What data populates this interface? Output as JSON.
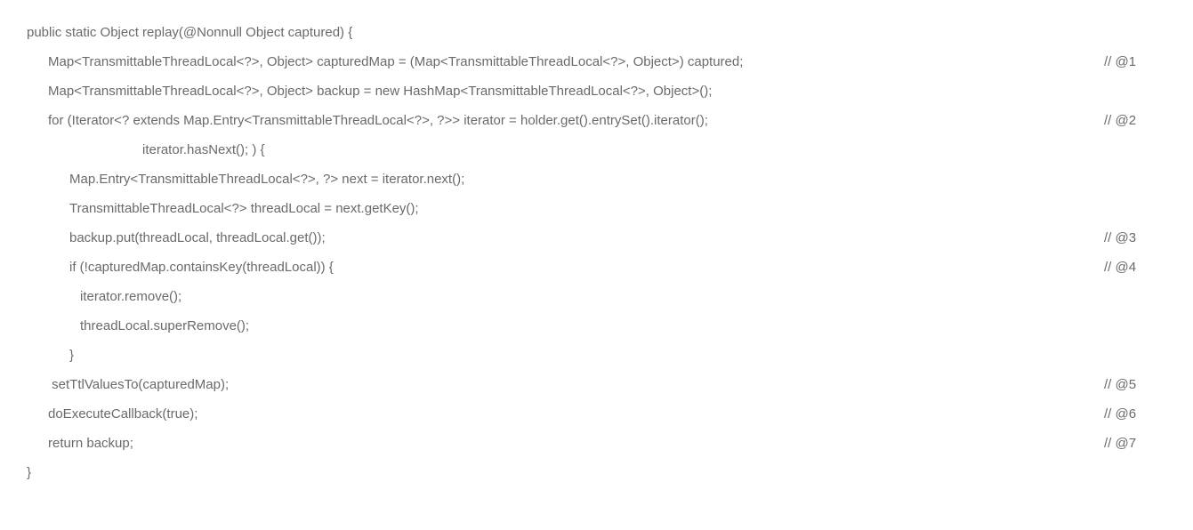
{
  "lines": [
    {
      "indent": "indent-0",
      "text": "public static Object replay(@Nonnull Object captured) {",
      "comment": ""
    },
    {
      "indent": "indent-1",
      "text": "Map<TransmittableThreadLocal<?>, Object> capturedMap = (Map<TransmittableThreadLocal<?>, Object>) captured;",
      "comment": "// @1"
    },
    {
      "indent": "indent-1",
      "text": "Map<TransmittableThreadLocal<?>, Object> backup = new HashMap<TransmittableThreadLocal<?>, Object>();",
      "comment": ""
    },
    {
      "indent": "indent-1",
      "text": "for (Iterator<? extends Map.Entry<TransmittableThreadLocal<?>, ?>> iterator = holder.get().entrySet().iterator();",
      "comment": "// @2"
    },
    {
      "indent": "indent-deep",
      "text": "iterator.hasNext(); ) {",
      "comment": ""
    },
    {
      "indent": "indent-2",
      "text": "Map.Entry<TransmittableThreadLocal<?>, ?> next = iterator.next();",
      "comment": ""
    },
    {
      "indent": "indent-2",
      "text": "TransmittableThreadLocal<?> threadLocal = next.getKey();",
      "comment": ""
    },
    {
      "indent": "indent-2",
      "text": "backup.put(threadLocal, threadLocal.get());",
      "comment": "// @3"
    },
    {
      "indent": "indent-2",
      "text": "if (!capturedMap.containsKey(threadLocal)) {",
      "comment": "// @4"
    },
    {
      "indent": "indent-3",
      "text": "iterator.remove();",
      "comment": ""
    },
    {
      "indent": "indent-3",
      "text": "threadLocal.superRemove();",
      "comment": ""
    },
    {
      "indent": "indent-2",
      "text": "}",
      "comment": ""
    },
    {
      "indent": "indent-1",
      "text": " setTtlValuesTo(capturedMap);",
      "comment": "// @5"
    },
    {
      "indent": "indent-1",
      "text": "doExecuteCallback(true);",
      "comment": "// @6"
    },
    {
      "indent": "indent-1",
      "text": "return backup;",
      "comment": "// @7"
    },
    {
      "indent": "indent-0",
      "text": "}",
      "comment": ""
    }
  ]
}
